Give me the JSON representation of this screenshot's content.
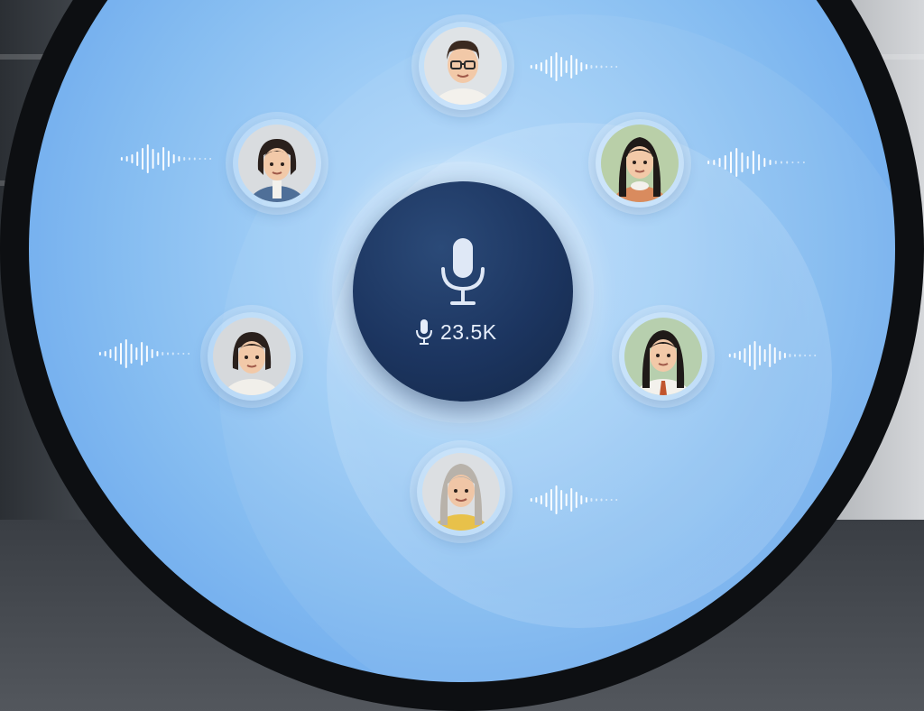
{
  "hub": {
    "icon": "microphone-icon",
    "listener_count": "23.5K"
  },
  "participants": [
    {
      "name_icon": "man-glasses-avatar",
      "speaking": true
    },
    {
      "name_icon": "woman-denim-jacket-avatar",
      "speaking": true
    },
    {
      "name_icon": "woman-orange-sweater-avatar",
      "speaking": true
    },
    {
      "name_icon": "girl-white-shirt-avatar",
      "speaking": true
    },
    {
      "name_icon": "girl-school-uniform-avatar",
      "speaking": true
    },
    {
      "name_icon": "elderly-woman-yellow-avatar",
      "speaking": true
    }
  ],
  "colors": {
    "hub": "#1c3560",
    "screen": "#86bdf1",
    "wave": "#ffffff"
  }
}
